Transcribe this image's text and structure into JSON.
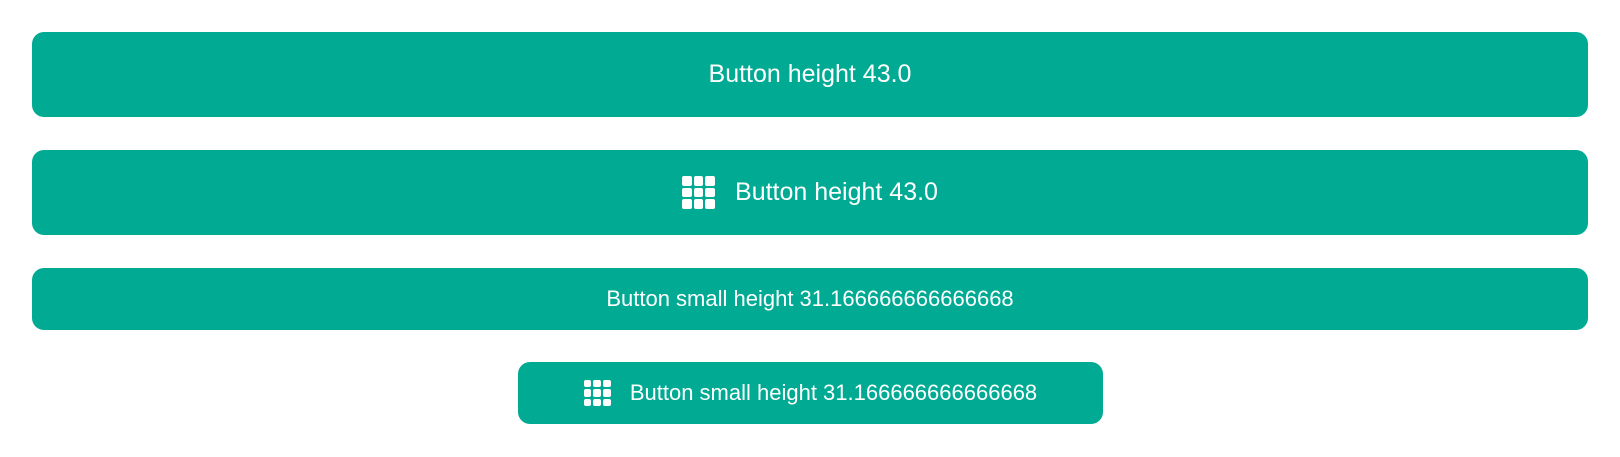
{
  "theme": {
    "button_color": "#00AA93",
    "text_color": "#FFFFFF"
  },
  "buttons": [
    {
      "label": "Button height 43.0",
      "icon": null
    },
    {
      "label": "Button height 43.0",
      "icon": "grid-icon"
    },
    {
      "label": "Button small height 31.166666666666668",
      "icon": null
    },
    {
      "label": "Button small height 31.166666666666668",
      "icon": "grid-icon"
    }
  ]
}
